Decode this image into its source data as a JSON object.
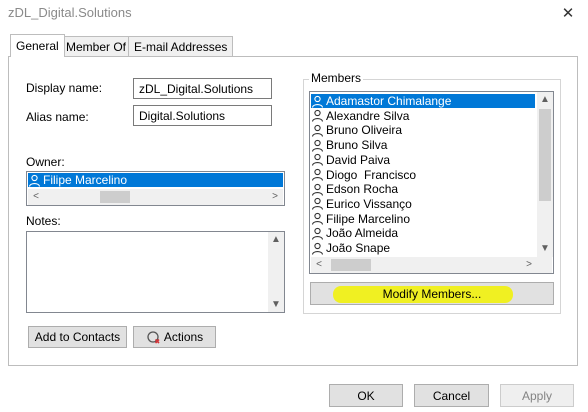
{
  "window": {
    "title": "zDL_Digital.Solutions",
    "close_glyph": "✕"
  },
  "tabs": [
    {
      "label": "General",
      "active": true
    },
    {
      "label": "Member Of",
      "active": false
    },
    {
      "label": "E-mail Addresses",
      "active": false
    }
  ],
  "general": {
    "display_name_label": "Display name:",
    "display_name_value": "zDL_Digital.Solutions",
    "alias_name_label": "Alias name:",
    "alias_name_value": "Digital.Solutions",
    "owner_label": "Owner:",
    "owner_value": "Filipe Marcelino",
    "notes_label": "Notes:",
    "notes_value": ""
  },
  "members": {
    "label": "Members",
    "items": [
      "Adamastor Chimalange",
      "Alexandre Silva",
      "Bruno Oliveira",
      "Bruno Silva",
      "David Paiva",
      "Diogo  Francisco",
      "Edson Rocha",
      "Eurico Vissanço",
      "Filipe Marcelino",
      "João Almeida",
      "João Snape"
    ],
    "selected_index": 0,
    "modify_button": "Modify Members..."
  },
  "actions": {
    "add_to_contacts": "Add to Contacts",
    "actions_label": "Actions"
  },
  "footer": {
    "ok": "OK",
    "cancel": "Cancel",
    "apply": "Apply"
  },
  "icons": {
    "person": "person-icon",
    "actions": "actions-icon",
    "close": "close-icon"
  },
  "colors": {
    "selection": "#0078d7",
    "highlight": "#f2f200"
  }
}
